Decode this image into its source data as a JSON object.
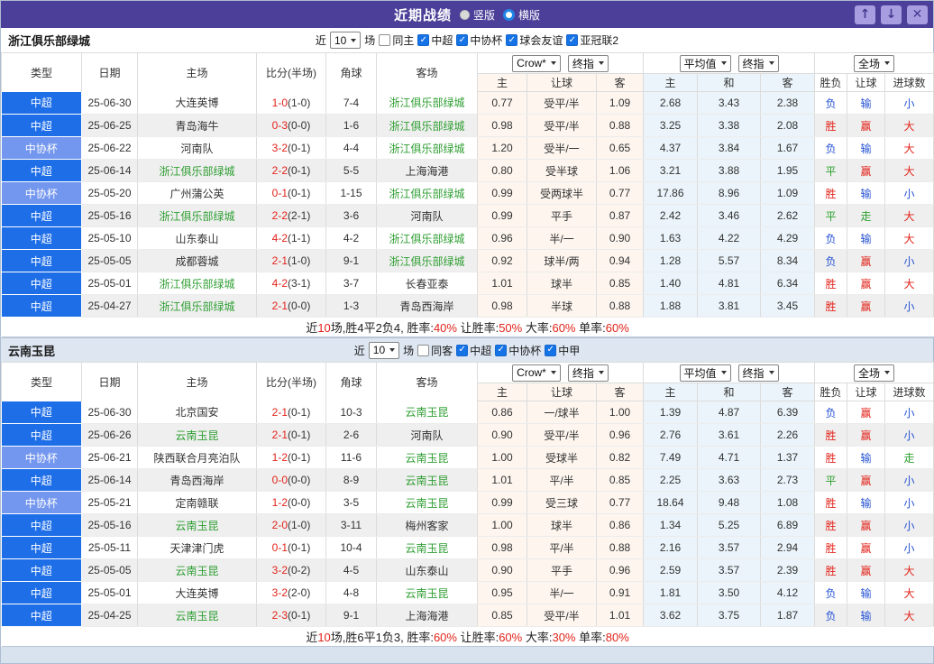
{
  "colors": {
    "titlebar_purple": "#4c3f99",
    "window_button_bg": "#a79de0",
    "league_csl_blue": "#1e6ee8",
    "league_cup_blue": "#7396ee",
    "win": "#e2231a",
    "loss": "#2653d4",
    "draw": "#2da12d",
    "score_red": "#e2231a",
    "team_highlight_green": "#2e9e32",
    "crow_column_bg": "#fdf5ee",
    "avg_column_bg": "#eaf4fa",
    "checkbox_blue": "#1673e6",
    "radio_selected_blue": "#1f86e8"
  },
  "result_color_map": {
    "胜": "win",
    "赢": "win",
    "大": "win",
    "负": "loss",
    "输": "loss",
    "小": "loss",
    "平": "draw",
    "走": "draw"
  },
  "titlebar": {
    "title": "近期战绩",
    "layout_options": [
      {
        "label": "竖版",
        "selected": false
      },
      {
        "label": "横版",
        "selected": true
      }
    ],
    "window_buttons": [
      {
        "name": "move-up-button",
        "glyph": "↑"
      },
      {
        "name": "move-down-button",
        "glyph": "↓"
      },
      {
        "name": "close-button",
        "glyph": "✕"
      }
    ]
  },
  "table_header": {
    "type": "类型",
    "date": "日期",
    "home": "主场",
    "score": "比分(半场)",
    "corner": "角球",
    "away": "客场",
    "odds_source_select": "Crow*",
    "odds_time_select": "终指",
    "avg_source_select": "平均值",
    "avg_time_select": "终指",
    "scope_select": "全场",
    "sub_home": "主",
    "sub_handicap": "让球",
    "sub_away": "客",
    "sub_avg_home": "主",
    "sub_avg_draw": "和",
    "sub_avg_away": "客",
    "sub_wl": "胜负",
    "sub_hcp_result": "让球",
    "sub_goals": "进球数"
  },
  "sections": [
    {
      "team": "浙江俱乐部绿城",
      "filter": {
        "prefix": "近",
        "count": "10",
        "suffix": "场",
        "checkboxes": [
          {
            "label": "同主",
            "checked": false
          },
          {
            "label": "中超",
            "checked": true
          },
          {
            "label": "中协杯",
            "checked": true
          },
          {
            "label": "球会友谊",
            "checked": true
          },
          {
            "label": "亚冠联2",
            "checked": true
          }
        ]
      },
      "rows": [
        {
          "league": "中超",
          "league_type": "csl",
          "date": "25-06-30",
          "home": "大连英博",
          "home_hl": false,
          "score_ft": "1-0",
          "score_ht": "(1-0)",
          "corner": "7-4",
          "away": "浙江俱乐部绿城",
          "away_hl": true,
          "crow_home": "0.77",
          "crow_handicap": "受平/半",
          "crow_away": "1.09",
          "avg_home": "2.68",
          "avg_draw": "3.43",
          "avg_away": "2.38",
          "res_wl": "负",
          "res_handicap": "输",
          "res_goals": "小"
        },
        {
          "league": "中超",
          "league_type": "csl",
          "date": "25-06-25",
          "home": "青岛海牛",
          "home_hl": false,
          "score_ft": "0-3",
          "score_ht": "(0-0)",
          "corner": "1-6",
          "away": "浙江俱乐部绿城",
          "away_hl": true,
          "crow_home": "0.98",
          "crow_handicap": "受平/半",
          "crow_away": "0.88",
          "avg_home": "3.25",
          "avg_draw": "3.38",
          "avg_away": "2.08",
          "res_wl": "胜",
          "res_handicap": "赢",
          "res_goals": "大"
        },
        {
          "league": "中协杯",
          "league_type": "cup",
          "date": "25-06-22",
          "home": "河南队",
          "home_hl": false,
          "score_ft": "3-2",
          "score_ht": "(0-1)",
          "corner": "4-4",
          "away": "浙江俱乐部绿城",
          "away_hl": true,
          "crow_home": "1.20",
          "crow_handicap": "受半/一",
          "crow_away": "0.65",
          "avg_home": "4.37",
          "avg_draw": "3.84",
          "avg_away": "1.67",
          "res_wl": "负",
          "res_handicap": "输",
          "res_goals": "大"
        },
        {
          "league": "中超",
          "league_type": "csl",
          "date": "25-06-14",
          "home": "浙江俱乐部绿城",
          "home_hl": true,
          "score_ft": "2-2",
          "score_ht": "(0-1)",
          "corner": "5-5",
          "away": "上海海港",
          "away_hl": false,
          "crow_home": "0.80",
          "crow_handicap": "受半球",
          "crow_away": "1.06",
          "avg_home": "3.21",
          "avg_draw": "3.88",
          "avg_away": "1.95",
          "res_wl": "平",
          "res_handicap": "赢",
          "res_goals": "大"
        },
        {
          "league": "中协杯",
          "league_type": "cup",
          "date": "25-05-20",
          "home": "广州蒲公英",
          "home_hl": false,
          "score_ft": "0-1",
          "score_ht": "(0-1)",
          "corner": "1-15",
          "away": "浙江俱乐部绿城",
          "away_hl": true,
          "crow_home": "0.99",
          "crow_handicap": "受两球半",
          "crow_away": "0.77",
          "avg_home": "17.86",
          "avg_draw": "8.96",
          "avg_away": "1.09",
          "res_wl": "胜",
          "res_handicap": "输",
          "res_goals": "小"
        },
        {
          "league": "中超",
          "league_type": "csl",
          "date": "25-05-16",
          "home": "浙江俱乐部绿城",
          "home_hl": true,
          "score_ft": "2-2",
          "score_ht": "(2-1)",
          "corner": "3-6",
          "away": "河南队",
          "away_hl": false,
          "crow_home": "0.99",
          "crow_handicap": "平手",
          "crow_away": "0.87",
          "avg_home": "2.42",
          "avg_draw": "3.46",
          "avg_away": "2.62",
          "res_wl": "平",
          "res_handicap": "走",
          "res_goals": "大"
        },
        {
          "league": "中超",
          "league_type": "csl",
          "date": "25-05-10",
          "home": "山东泰山",
          "home_hl": false,
          "score_ft": "4-2",
          "score_ht": "(1-1)",
          "corner": "4-2",
          "away": "浙江俱乐部绿城",
          "away_hl": true,
          "crow_home": "0.96",
          "crow_handicap": "半/一",
          "crow_away": "0.90",
          "avg_home": "1.63",
          "avg_draw": "4.22",
          "avg_away": "4.29",
          "res_wl": "负",
          "res_handicap": "输",
          "res_goals": "大"
        },
        {
          "league": "中超",
          "league_type": "csl",
          "date": "25-05-05",
          "home": "成都蓉城",
          "home_hl": false,
          "score_ft": "2-1",
          "score_ht": "(1-0)",
          "corner": "9-1",
          "away": "浙江俱乐部绿城",
          "away_hl": true,
          "crow_home": "0.92",
          "crow_handicap": "球半/两",
          "crow_away": "0.94",
          "avg_home": "1.28",
          "avg_draw": "5.57",
          "avg_away": "8.34",
          "res_wl": "负",
          "res_handicap": "赢",
          "res_goals": "小"
        },
        {
          "league": "中超",
          "league_type": "csl",
          "date": "25-05-01",
          "home": "浙江俱乐部绿城",
          "home_hl": true,
          "score_ft": "4-2",
          "score_ht": "(3-1)",
          "corner": "3-7",
          "away": "长春亚泰",
          "away_hl": false,
          "crow_home": "1.01",
          "crow_handicap": "球半",
          "crow_away": "0.85",
          "avg_home": "1.40",
          "avg_draw": "4.81",
          "avg_away": "6.34",
          "res_wl": "胜",
          "res_handicap": "赢",
          "res_goals": "大"
        },
        {
          "league": "中超",
          "league_type": "csl",
          "date": "25-04-27",
          "home": "浙江俱乐部绿城",
          "home_hl": true,
          "score_ft": "2-1",
          "score_ht": "(0-0)",
          "corner": "1-3",
          "away": "青岛西海岸",
          "away_hl": false,
          "crow_home": "0.98",
          "crow_handicap": "半球",
          "crow_away": "0.88",
          "avg_home": "1.88",
          "avg_draw": "3.81",
          "avg_away": "3.45",
          "res_wl": "胜",
          "res_handicap": "赢",
          "res_goals": "小"
        }
      ],
      "summary": [
        {
          "text": "近"
        },
        {
          "text": "10",
          "red": true
        },
        {
          "text": "场,胜4平2负4, 胜率:"
        },
        {
          "text": "40%",
          "red": true
        },
        {
          "text": " 让胜率:"
        },
        {
          "text": "50%",
          "red": true
        },
        {
          "text": " 大率:"
        },
        {
          "text": "60%",
          "red": true
        },
        {
          "text": " 单率:"
        },
        {
          "text": "60%",
          "red": true
        }
      ]
    },
    {
      "team": "云南玉昆",
      "filter": {
        "prefix": "近",
        "count": "10",
        "suffix": "场",
        "checkboxes": [
          {
            "label": "同客",
            "checked": false
          },
          {
            "label": "中超",
            "checked": true
          },
          {
            "label": "中协杯",
            "checked": true
          },
          {
            "label": "中甲",
            "checked": true
          }
        ]
      },
      "rows": [
        {
          "league": "中超",
          "league_type": "csl",
          "date": "25-06-30",
          "home": "北京国安",
          "home_hl": false,
          "score_ft": "2-1",
          "score_ht": "(0-1)",
          "corner": "10-3",
          "away": "云南玉昆",
          "away_hl": true,
          "crow_home": "0.86",
          "crow_handicap": "一/球半",
          "crow_away": "1.00",
          "avg_home": "1.39",
          "avg_draw": "4.87",
          "avg_away": "6.39",
          "res_wl": "负",
          "res_handicap": "赢",
          "res_goals": "小"
        },
        {
          "league": "中超",
          "league_type": "csl",
          "date": "25-06-26",
          "home": "云南玉昆",
          "home_hl": true,
          "score_ft": "2-1",
          "score_ht": "(0-1)",
          "corner": "2-6",
          "away": "河南队",
          "away_hl": false,
          "crow_home": "0.90",
          "crow_handicap": "受平/半",
          "crow_away": "0.96",
          "avg_home": "2.76",
          "avg_draw": "3.61",
          "avg_away": "2.26",
          "res_wl": "胜",
          "res_handicap": "赢",
          "res_goals": "小"
        },
        {
          "league": "中协杯",
          "league_type": "cup",
          "date": "25-06-21",
          "home": "陕西联合月亮泊队",
          "home_hl": false,
          "score_ft": "1-2",
          "score_ht": "(0-1)",
          "corner": "11-6",
          "away": "云南玉昆",
          "away_hl": true,
          "crow_home": "1.00",
          "crow_handicap": "受球半",
          "crow_away": "0.82",
          "avg_home": "7.49",
          "avg_draw": "4.71",
          "avg_away": "1.37",
          "res_wl": "胜",
          "res_handicap": "输",
          "res_goals": "走"
        },
        {
          "league": "中超",
          "league_type": "csl",
          "date": "25-06-14",
          "home": "青岛西海岸",
          "home_hl": false,
          "score_ft": "0-0",
          "score_ht": "(0-0)",
          "corner": "8-9",
          "away": "云南玉昆",
          "away_hl": true,
          "crow_home": "1.01",
          "crow_handicap": "平/半",
          "crow_away": "0.85",
          "avg_home": "2.25",
          "avg_draw": "3.63",
          "avg_away": "2.73",
          "res_wl": "平",
          "res_handicap": "赢",
          "res_goals": "小"
        },
        {
          "league": "中协杯",
          "league_type": "cup",
          "date": "25-05-21",
          "home": "定南赣联",
          "home_hl": false,
          "score_ft": "1-2",
          "score_ht": "(0-0)",
          "corner": "3-5",
          "away": "云南玉昆",
          "away_hl": true,
          "crow_home": "0.99",
          "crow_handicap": "受三球",
          "crow_away": "0.77",
          "avg_home": "18.64",
          "avg_draw": "9.48",
          "avg_away": "1.08",
          "res_wl": "胜",
          "res_handicap": "输",
          "res_goals": "小"
        },
        {
          "league": "中超",
          "league_type": "csl",
          "date": "25-05-16",
          "home": "云南玉昆",
          "home_hl": true,
          "score_ft": "2-0",
          "score_ht": "(1-0)",
          "corner": "3-11",
          "away": "梅州客家",
          "away_hl": false,
          "crow_home": "1.00",
          "crow_handicap": "球半",
          "crow_away": "0.86",
          "avg_home": "1.34",
          "avg_draw": "5.25",
          "avg_away": "6.89",
          "res_wl": "胜",
          "res_handicap": "赢",
          "res_goals": "小"
        },
        {
          "league": "中超",
          "league_type": "csl",
          "date": "25-05-11",
          "home": "天津津门虎",
          "home_hl": false,
          "score_ft": "0-1",
          "score_ht": "(0-1)",
          "corner": "10-4",
          "away": "云南玉昆",
          "away_hl": true,
          "crow_home": "0.98",
          "crow_handicap": "平/半",
          "crow_away": "0.88",
          "avg_home": "2.16",
          "avg_draw": "3.57",
          "avg_away": "2.94",
          "res_wl": "胜",
          "res_handicap": "赢",
          "res_goals": "小"
        },
        {
          "league": "中超",
          "league_type": "csl",
          "date": "25-05-05",
          "home": "云南玉昆",
          "home_hl": true,
          "score_ft": "3-2",
          "score_ht": "(0-2)",
          "corner": "4-5",
          "away": "山东泰山",
          "away_hl": false,
          "crow_home": "0.90",
          "crow_handicap": "平手",
          "crow_away": "0.96",
          "avg_home": "2.59",
          "avg_draw": "3.57",
          "avg_away": "2.39",
          "res_wl": "胜",
          "res_handicap": "赢",
          "res_goals": "大"
        },
        {
          "league": "中超",
          "league_type": "csl",
          "date": "25-05-01",
          "home": "大连英博",
          "home_hl": false,
          "score_ft": "3-2",
          "score_ht": "(2-0)",
          "corner": "4-8",
          "away": "云南玉昆",
          "away_hl": true,
          "crow_home": "0.95",
          "crow_handicap": "半/一",
          "crow_away": "0.91",
          "avg_home": "1.81",
          "avg_draw": "3.50",
          "avg_away": "4.12",
          "res_wl": "负",
          "res_handicap": "输",
          "res_goals": "大"
        },
        {
          "league": "中超",
          "league_type": "csl",
          "date": "25-04-25",
          "home": "云南玉昆",
          "home_hl": true,
          "score_ft": "2-3",
          "score_ht": "(0-1)",
          "corner": "9-1",
          "away": "上海海港",
          "away_hl": false,
          "crow_home": "0.85",
          "crow_handicap": "受平/半",
          "crow_away": "1.01",
          "avg_home": "3.62",
          "avg_draw": "3.75",
          "avg_away": "1.87",
          "res_wl": "负",
          "res_handicap": "输",
          "res_goals": "大"
        }
      ],
      "summary": [
        {
          "text": "近"
        },
        {
          "text": "10",
          "red": true
        },
        {
          "text": "场,胜6平1负3, 胜率:"
        },
        {
          "text": "60%",
          "red": true
        },
        {
          "text": " 让胜率:"
        },
        {
          "text": "60%",
          "red": true
        },
        {
          "text": " 大率:"
        },
        {
          "text": "30%",
          "red": true
        },
        {
          "text": " 单率:"
        },
        {
          "text": "80%",
          "red": true
        }
      ]
    }
  ]
}
